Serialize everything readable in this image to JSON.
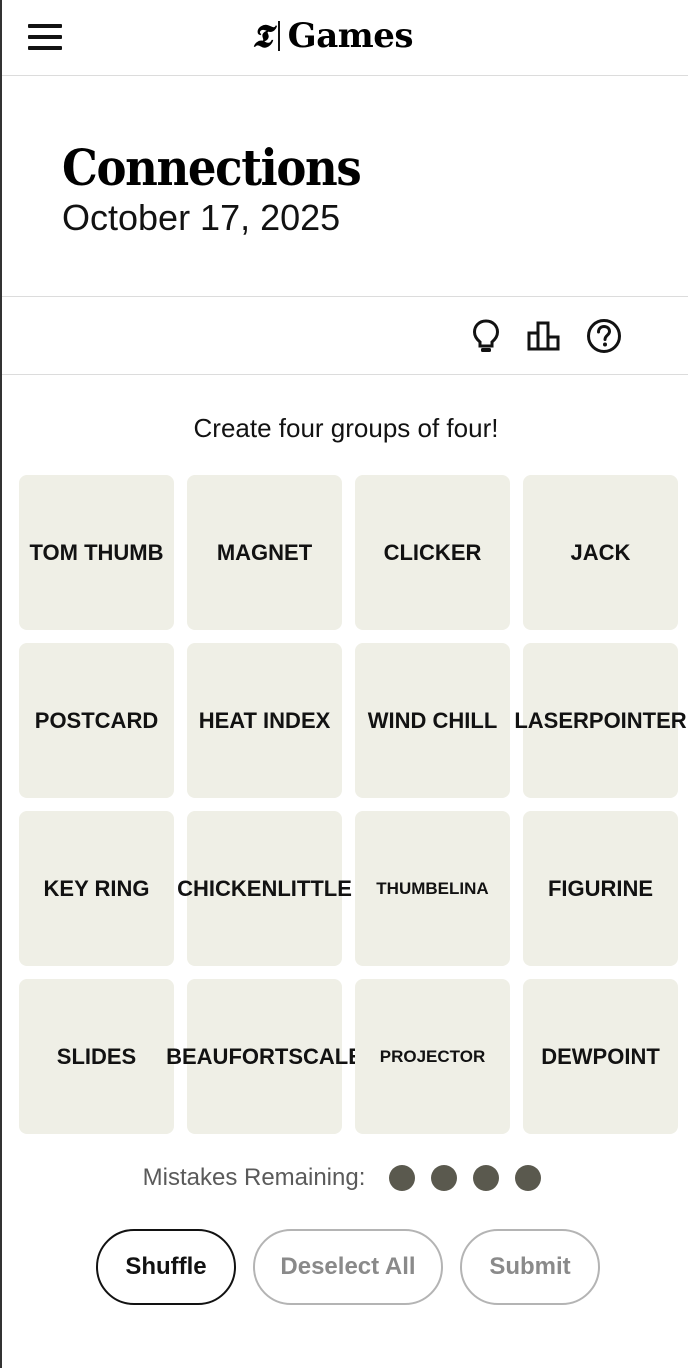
{
  "header": {
    "logo_mark": "𝕿",
    "logo_text": "Games"
  },
  "page": {
    "title": "Connections",
    "date": "October 17, 2025"
  },
  "toolbar": {
    "hint_icon": "lightbulb-icon",
    "stats_icon": "leaderboard-icon",
    "help_icon": "help-icon"
  },
  "instructions": "Create four groups of four!",
  "tiles": [
    {
      "lines": [
        "TOM THUMB"
      ]
    },
    {
      "lines": [
        "MAGNET"
      ]
    },
    {
      "lines": [
        "CLICKER"
      ]
    },
    {
      "lines": [
        "JACK"
      ]
    },
    {
      "lines": [
        "POSTCARD"
      ]
    },
    {
      "lines": [
        "HEAT INDEX"
      ]
    },
    {
      "lines": [
        "WIND CHILL"
      ]
    },
    {
      "lines": [
        "LASER",
        "POINTER"
      ]
    },
    {
      "lines": [
        "KEY RING"
      ]
    },
    {
      "lines": [
        "CHICKEN",
        "LITTLE"
      ]
    },
    {
      "lines": [
        "THUMBELINA"
      ],
      "small": true
    },
    {
      "lines": [
        "FIGURINE"
      ]
    },
    {
      "lines": [
        "SLIDES"
      ]
    },
    {
      "lines": [
        "BEAUFORT",
        "SCALE"
      ]
    },
    {
      "lines": [
        "PROJECTOR"
      ],
      "small": true
    },
    {
      "lines": [
        "DEWPOINT"
      ]
    }
  ],
  "mistakes": {
    "label": "Mistakes Remaining:",
    "remaining": 4
  },
  "buttons": {
    "shuffle": "Shuffle",
    "deselect_all": "Deselect All",
    "submit": "Submit"
  },
  "colors": {
    "tile_bg": "#efefe6",
    "dot": "#5a594e",
    "disabled_text": "#8a8a8a"
  }
}
